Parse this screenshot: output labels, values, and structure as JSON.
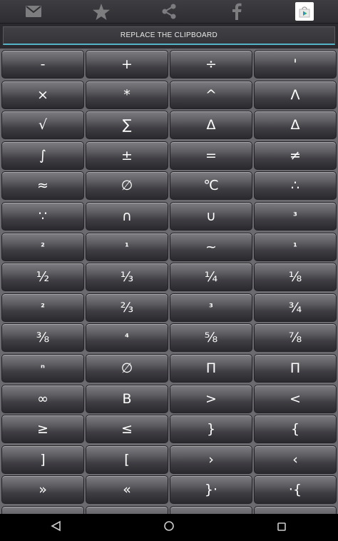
{
  "topbar": {
    "icons": [
      "mail-icon",
      "star-icon",
      "share-icon",
      "facebook-icon",
      "play-store-icon"
    ]
  },
  "replace_button": {
    "label": "REPLACE THE CLIPBOARD"
  },
  "colors": {
    "accent": "#55b4c8",
    "background": "#6b6a6e"
  },
  "keys": [
    "-",
    "+",
    "÷",
    "'",
    "×",
    "*",
    "^",
    "Λ",
    "√",
    "∑",
    "Δ",
    "Δ",
    "∫",
    "±",
    "=",
    "≠",
    "≈",
    "∅",
    "℃",
    "∴",
    "∵",
    "∩",
    "∪",
    "³",
    "²",
    "¹",
    "~",
    "¹",
    "½",
    "⅓",
    "¼",
    "⅛",
    "²",
    "⅔",
    "³",
    "¾",
    "⅜",
    "⁴",
    "⅝",
    "⅞",
    "ⁿ",
    "∅",
    "Π",
    "Π",
    "∞",
    "B",
    ">",
    "<",
    "≥",
    "≤",
    "}",
    "{",
    "]",
    "[",
    "›",
    "‹",
    "»",
    "«",
    "}·",
    "·{",
    "",
    "",
    "",
    ""
  ],
  "navbar": {
    "icons": [
      "back-icon",
      "home-icon",
      "recents-icon"
    ]
  }
}
